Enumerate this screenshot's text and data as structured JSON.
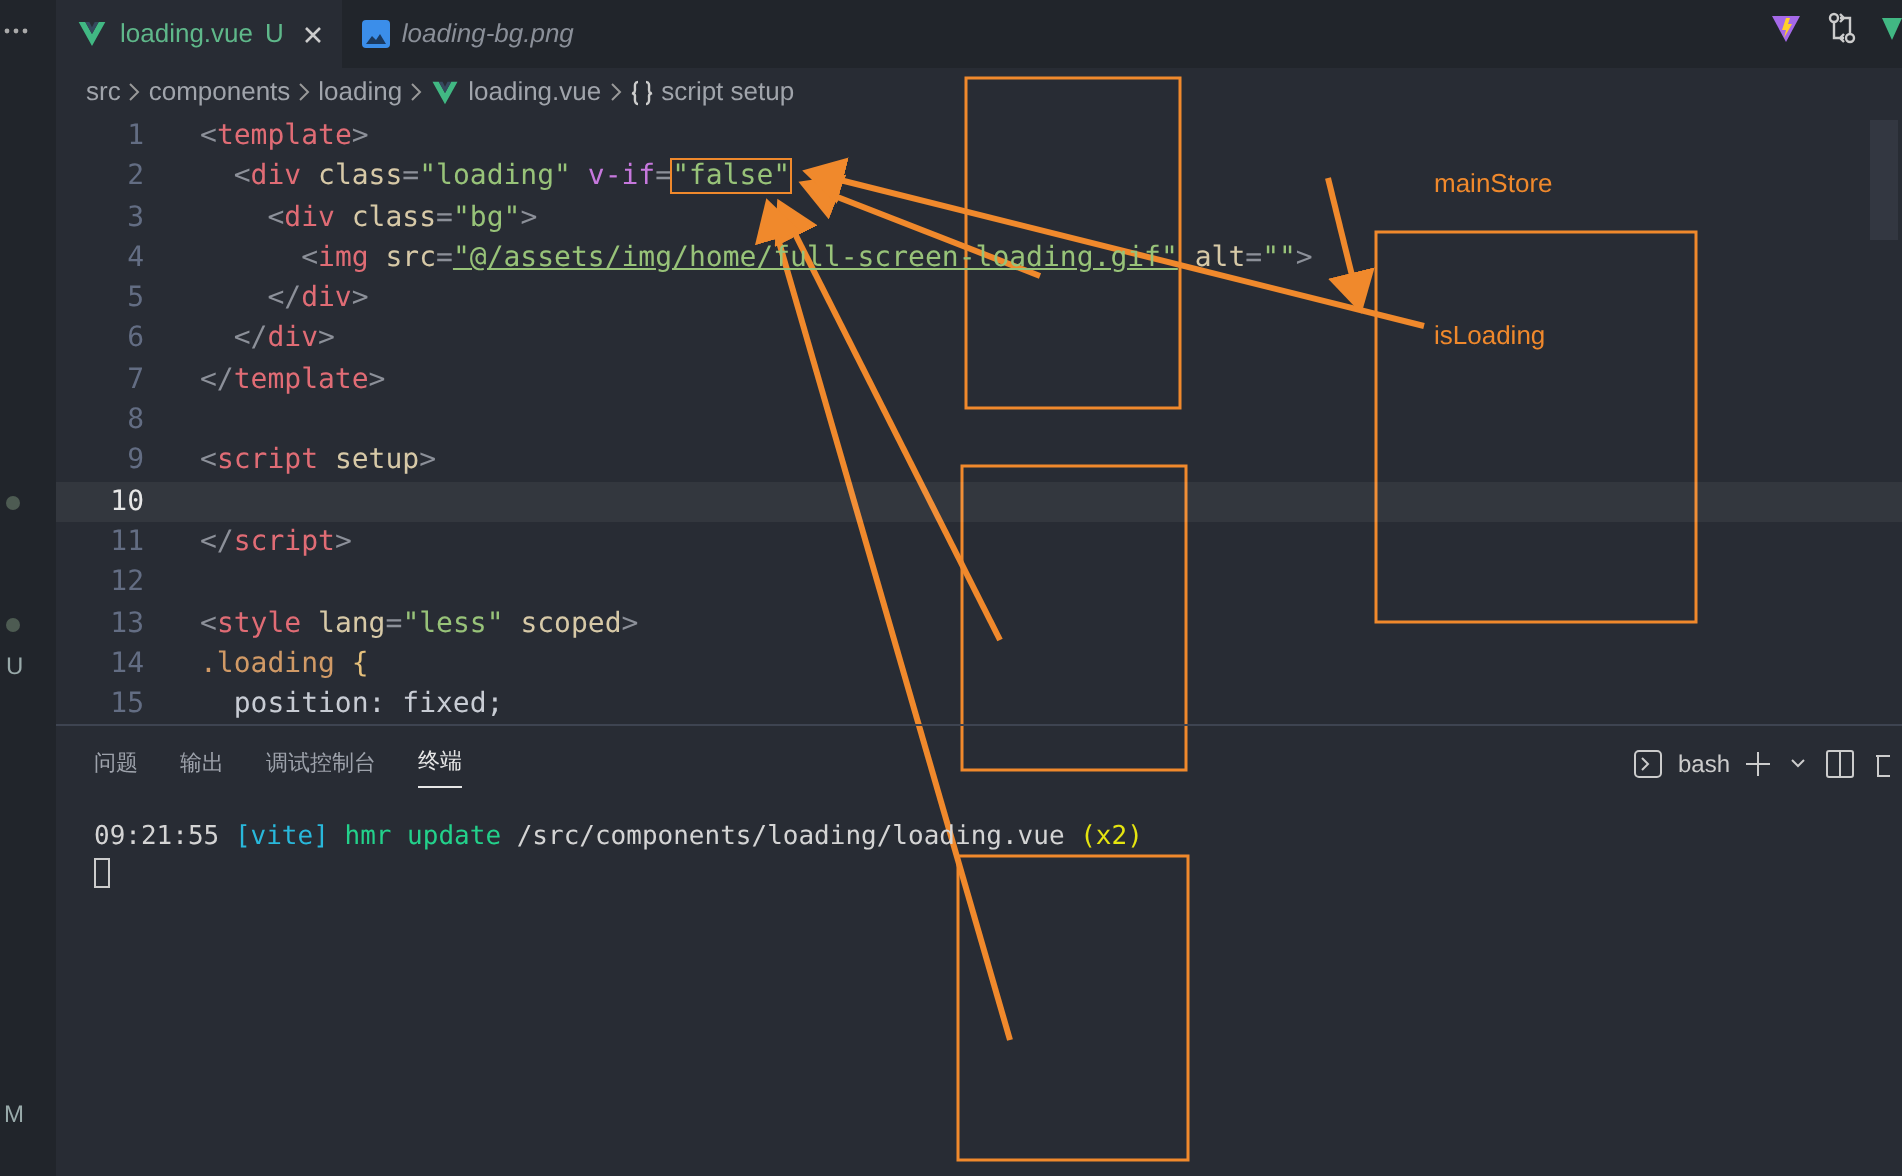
{
  "editor_tabs": [
    {
      "label": "loading.vue",
      "badge": "U",
      "kind": "component-file",
      "selected": true
    },
    {
      "label": "loading-bg.png",
      "kind": "image-file",
      "selected": false
    }
  ],
  "breadcrumb": [
    {
      "text": "src",
      "kind": "folder"
    },
    {
      "text": "components",
      "kind": "folder"
    },
    {
      "text": "loading",
      "kind": "folder"
    },
    {
      "text": "loading.vue",
      "kind": "component-file"
    },
    {
      "text": "script setup",
      "kind": "symbol"
    }
  ],
  "code_lines": [
    {
      "number": "1",
      "current": false,
      "tokens": [
        {
          "kind": "punct",
          "text": "<"
        },
        {
          "kind": "tag",
          "text": "template"
        },
        {
          "kind": "punct",
          "text": ">"
        }
      ]
    },
    {
      "number": "2",
      "current": false,
      "tokens": [
        {
          "kind": "punct",
          "text": "  <"
        },
        {
          "kind": "tag",
          "text": "div"
        },
        {
          "kind": "attr",
          "text": " class"
        },
        {
          "kind": "punct",
          "text": "="
        },
        {
          "kind": "string",
          "text": "\"loading\""
        },
        {
          "kind": "directive",
          "text": " v-if"
        },
        {
          "kind": "punct",
          "text": "="
        },
        {
          "kind": "string",
          "text": "\"false\"",
          "boxed": true
        }
      ]
    },
    {
      "number": "3",
      "current": false,
      "tokens": [
        {
          "kind": "punct",
          "text": "    <"
        },
        {
          "kind": "tag",
          "text": "div"
        },
        {
          "kind": "attr",
          "text": " class"
        },
        {
          "kind": "punct",
          "text": "="
        },
        {
          "kind": "string",
          "text": "\"bg\""
        },
        {
          "kind": "punct",
          "text": ">"
        }
      ]
    },
    {
      "number": "4",
      "current": false,
      "tokens": [
        {
          "kind": "punct",
          "text": "      <"
        },
        {
          "kind": "tag",
          "text": "img"
        },
        {
          "kind": "attr",
          "text": " src"
        },
        {
          "kind": "punct",
          "text": "="
        },
        {
          "kind": "link",
          "text": "\"@/assets/img/home/full-screen-loading.gif\""
        },
        {
          "kind": "attr",
          "text": " alt"
        },
        {
          "kind": "punct",
          "text": "="
        },
        {
          "kind": "string",
          "text": "\"\""
        },
        {
          "kind": "punct",
          "text": ">"
        }
      ]
    },
    {
      "number": "5",
      "current": false,
      "tokens": [
        {
          "kind": "punct",
          "text": "    </"
        },
        {
          "kind": "tag",
          "text": "div"
        },
        {
          "kind": "punct",
          "text": ">"
        }
      ]
    },
    {
      "number": "6",
      "current": false,
      "tokens": [
        {
          "kind": "punct",
          "text": "  </"
        },
        {
          "kind": "tag",
          "text": "div"
        },
        {
          "kind": "punct",
          "text": ">"
        }
      ]
    },
    {
      "number": "7",
      "current": false,
      "tokens": [
        {
          "kind": "punct",
          "text": "</"
        },
        {
          "kind": "tag",
          "text": "template"
        },
        {
          "kind": "punct",
          "text": ">"
        }
      ]
    },
    {
      "number": "8",
      "current": false
    },
    {
      "number": "9",
      "current": false,
      "tokens": [
        {
          "kind": "punct",
          "text": "<"
        },
        {
          "kind": "tag",
          "text": "script"
        },
        {
          "kind": "attr",
          "text": " setup"
        },
        {
          "kind": "punct",
          "text": ">"
        }
      ]
    },
    {
      "number": "10",
      "current": true,
      "gutter_dot": true
    },
    {
      "number": "11",
      "current": false,
      "tokens": [
        {
          "kind": "punct",
          "text": "</"
        },
        {
          "kind": "tag",
          "text": "script"
        },
        {
          "kind": "punct",
          "text": ">"
        }
      ]
    },
    {
      "number": "12",
      "current": false
    },
    {
      "number": "13",
      "current": false,
      "gutter_dot": true,
      "tokens": [
        {
          "kind": "punct",
          "text": "<"
        },
        {
          "kind": "tag",
          "text": "style"
        },
        {
          "kind": "attr",
          "text": " lang"
        },
        {
          "kind": "punct",
          "text": "="
        },
        {
          "kind": "string",
          "text": "\"less\""
        },
        {
          "kind": "attr",
          "text": " scoped"
        },
        {
          "kind": "punct",
          "text": ">"
        }
      ]
    },
    {
      "number": "14",
      "current": false,
      "gutter_text": "U",
      "tokens": [
        {
          "kind": "selector",
          "text": ".loading"
        },
        {
          "kind": "brace",
          "text": " {"
        }
      ]
    },
    {
      "number": "15",
      "current": false,
      "tokens": [
        {
          "kind": "prop",
          "text": "  position: fixed;"
        }
      ]
    }
  ],
  "panel": {
    "tabs": [
      {
        "label": "问题",
        "selected": false
      },
      {
        "label": "输出",
        "selected": false
      },
      {
        "label": "调试控制台",
        "selected": false
      },
      {
        "label": "终端",
        "selected": true
      }
    ],
    "shell": "bash",
    "terminal_tokens": [
      {
        "kind": "time",
        "text": "09:21:55"
      },
      {
        "kind": "tag",
        "text": "[vite]"
      },
      {
        "kind": "action",
        "text": "hmr update"
      },
      {
        "kind": "path",
        "text": "/src/components/loading/loading.vue"
      },
      {
        "kind": "count",
        "text": "(x2)"
      }
    ]
  },
  "sidebar_letter": "M",
  "annotations": [
    {
      "text": "mainStore"
    },
    {
      "text": "isLoading"
    }
  ]
}
